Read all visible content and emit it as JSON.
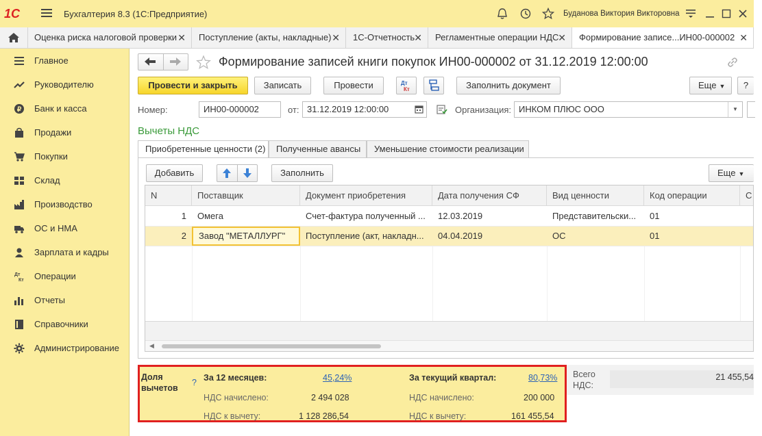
{
  "titlebar": {
    "logo": "1С",
    "title": "Бухгалтерия 8.3  (1С:Предприятие)",
    "user": "Буданова Виктория Викторовна"
  },
  "tabs": [
    {
      "label": "Оценка риска налоговой проверки"
    },
    {
      "label": "Поступление (акты, накладные)"
    },
    {
      "label": "1С-Отчетность"
    },
    {
      "label": "Регламентные операции НДС"
    },
    {
      "label": "Формирование записе...ИН00-000002"
    }
  ],
  "sidebar": {
    "items": [
      {
        "label": "Главное",
        "icon": "menu-list-icon"
      },
      {
        "label": "Руководителю",
        "icon": "trend-icon"
      },
      {
        "label": "Банк и касса",
        "icon": "coin-icon"
      },
      {
        "label": "Продажи",
        "icon": "bag-icon"
      },
      {
        "label": "Покупки",
        "icon": "cart-icon"
      },
      {
        "label": "Склад",
        "icon": "warehouse-icon"
      },
      {
        "label": "Производство",
        "icon": "factory-icon"
      },
      {
        "label": "ОС и НМА",
        "icon": "truck-icon"
      },
      {
        "label": "Зарплата и кадры",
        "icon": "person-icon"
      },
      {
        "label": "Операции",
        "icon": "dt-kt-icon"
      },
      {
        "label": "Отчеты",
        "icon": "bar-chart-icon"
      },
      {
        "label": "Справочники",
        "icon": "book-icon"
      },
      {
        "label": "Администрирование",
        "icon": "gear-icon"
      }
    ]
  },
  "document": {
    "title": "Формирование записей книги покупок ИН00-000002 от 31.12.2019 12:00:00"
  },
  "toolbar": {
    "post_close": "Провести и закрыть",
    "save": "Записать",
    "post": "Провести",
    "dtkt": "Дт Кт",
    "fill_doc": "Заполнить документ",
    "more": "Еще",
    "help": "?"
  },
  "header": {
    "number_label": "Номер:",
    "number_value": "ИН00-000002",
    "date_label": "от:",
    "date_value": "31.12.2019 12:00:00",
    "org_label": "Организация:",
    "org_value": "ИНКОМ ПЛЮС ООО"
  },
  "section_title": "Вычеты НДС",
  "subtabs": [
    {
      "label": "Приобретенные ценности (2)"
    },
    {
      "label": "Полученные авансы"
    },
    {
      "label": "Уменьшение стоимости реализации"
    }
  ],
  "table_toolbar": {
    "add": "Добавить",
    "fill": "Заполнить",
    "more": "Еще"
  },
  "table": {
    "columns": [
      "N",
      "Поставщик",
      "Документ приобретения",
      "Дата получения СФ",
      "Вид ценности",
      "Код операции",
      "С"
    ],
    "rows": [
      {
        "n": "1",
        "supplier": "Омега",
        "doc": "Счет-фактура полученный ...",
        "date": "12.03.2019",
        "kind": "Представительски...",
        "code": "01"
      },
      {
        "n": "2",
        "supplier": "Завод \"МЕТАЛЛУРГ\"",
        "doc": "Поступление (акт, накладн...",
        "date": "04.04.2019",
        "kind": "ОС",
        "code": "01"
      }
    ]
  },
  "summary": {
    "share_label_1": "Доля",
    "share_label_2": "вычетов",
    "help": "?",
    "m12_title": "За 12 месяцев:",
    "m12_pct": "45,24%",
    "m12_accrued_label": "НДС начислено:",
    "m12_accrued": "2 494 028",
    "m12_deduct_label": "НДС к вычету:",
    "m12_deduct": "1 128 286,54",
    "q_title": "За текущий квартал:",
    "q_pct": "80,73%",
    "q_accrued_label": "НДС начислено:",
    "q_accrued": "200 000",
    "q_deduct_label": "НДС к вычету:",
    "q_deduct": "161 455,54",
    "total_label_1": "Всего",
    "total_label_2": "НДС:",
    "total_value": "21 455,54"
  }
}
